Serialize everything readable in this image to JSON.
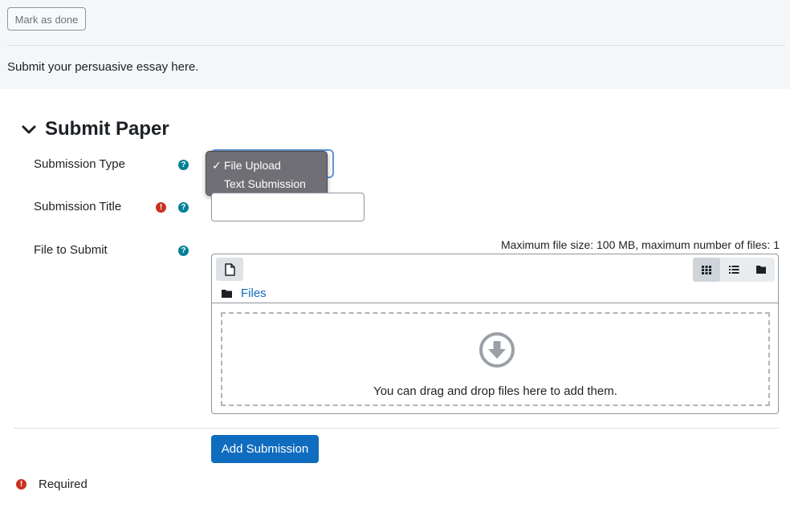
{
  "header": {
    "mark_done_label": "Mark as done",
    "description": "Submit your persuasive essay here."
  },
  "section": {
    "title": "Submit Paper"
  },
  "form": {
    "submission_type": {
      "label": "Submission Type",
      "selected": "File Upload",
      "options": [
        "File Upload",
        "Text Submission"
      ]
    },
    "submission_title": {
      "label": "Submission Title",
      "value": ""
    },
    "file_to_submit": {
      "label": "File to Submit",
      "max_info": "Maximum file size: 100 MB, maximum number of files: 1",
      "breadcrumb": "Files",
      "dropzone_text": "You can drag and drop files here to add them."
    }
  },
  "actions": {
    "submit_label": "Add Submission"
  },
  "legend": {
    "required_label": "Required"
  },
  "colors": {
    "primary": "#0f6cbf",
    "help": "#008196",
    "required": "#ca3120"
  }
}
